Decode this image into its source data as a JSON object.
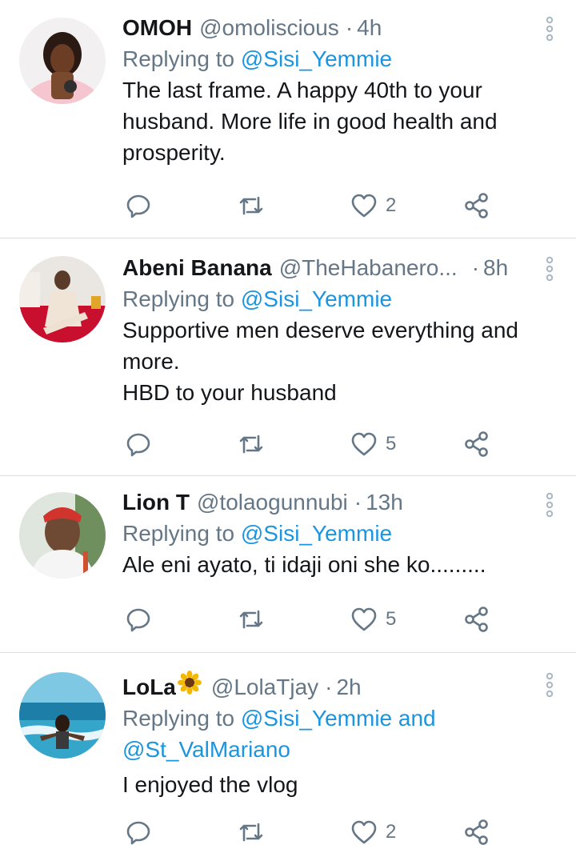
{
  "tweets": [
    {
      "name": "OMOH",
      "handle": "@omoliscious",
      "dot": "·",
      "time": "4h",
      "replying_prefix": "Replying to",
      "mentions": [
        "@Sisi_Yemmie"
      ],
      "text_lines": [
        "The last frame. A happy 40th to your",
        "husband. More life in good health and",
        "prosperity."
      ],
      "likes": "2"
    },
    {
      "name": "Abeni Banana",
      "handle": "@TheHabanero...",
      "dot": "·",
      "time": "8h",
      "replying_prefix": "Replying to",
      "mentions": [
        "@Sisi_Yemmie"
      ],
      "text_lines": [
        "Supportive men deserve everything and",
        "more.",
        "HBD to your husband"
      ],
      "likes": "5"
    },
    {
      "name": "Lion T",
      "handle": "@tolaogunnubi",
      "dot": "·",
      "time": "13h",
      "replying_prefix": "Replying to",
      "mentions": [
        "@Sisi_Yemmie"
      ],
      "text_lines": [
        "Ale eni ayato, ti idaji oni she ko........."
      ],
      "likes": "5"
    },
    {
      "name": "LoLa",
      "name_emoji": "sunflower",
      "handle": "@LolaTjay",
      "dot": "·",
      "time": "2h",
      "replying_prefix": "Replying to",
      "mentions": [
        "@Sisi_Yemmie",
        "@St_ValMariano"
      ],
      "mention_joiner": "and",
      "text_lines": [
        "I enjoyed the vlog"
      ],
      "likes": "2"
    }
  ],
  "icons": {
    "reply": "reply-icon",
    "retweet": "retweet-icon",
    "like": "heart-icon",
    "share": "share-icon",
    "more": "more-vertical-icon"
  },
  "colors": {
    "text": "#14171a",
    "secondary": "#657786",
    "link": "#1b95e0",
    "divider": "#d9dde1"
  }
}
